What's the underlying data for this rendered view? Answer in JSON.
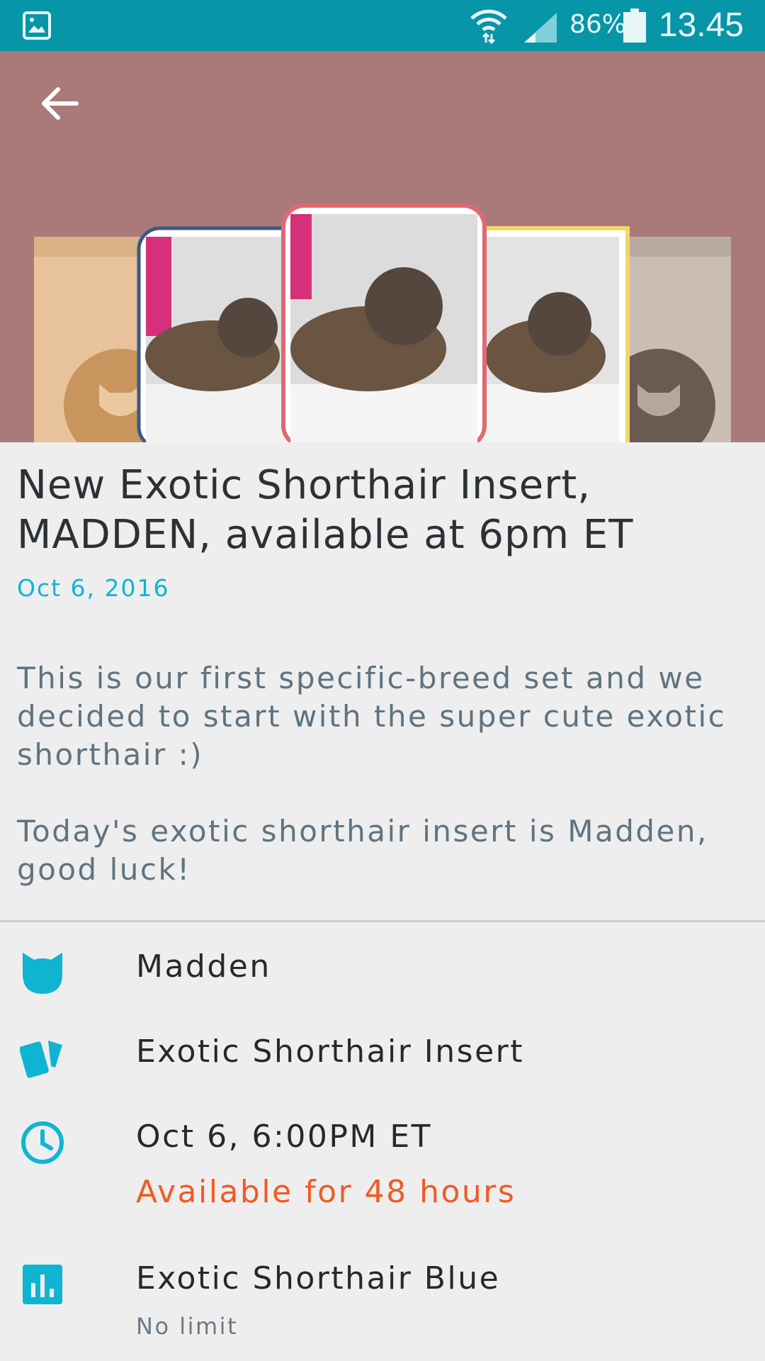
{
  "status_bar": {
    "battery_percent": "86%",
    "time": "13.45"
  },
  "article": {
    "title": "New Exotic Shorthair Insert, MADDEN, available at 6pm ET",
    "date": "Oct 6, 2016",
    "paragraphs": [
      "This is our first specific-breed set and we decided to start with the super cute exotic shorthair :)",
      "Today's exotic shorthair insert is Madden, good luck!"
    ]
  },
  "details": {
    "name": "Madden",
    "set": "Exotic Shorthair Insert",
    "time": "Oct 6, 6:00PM ET",
    "availability": "Available for 48 hours",
    "variant": "Exotic Shorthair Blue",
    "limit": "No limit"
  },
  "colors": {
    "status_bar": "#0795a8",
    "hero_background": "#a97a79",
    "accent": "#10b4d3",
    "availability": "#f15a24"
  },
  "icons": {
    "back": "arrow-left-icon",
    "name": "cat-head-icon",
    "set": "cards-icon",
    "time": "clock-icon",
    "variant": "bar-chart-icon"
  }
}
